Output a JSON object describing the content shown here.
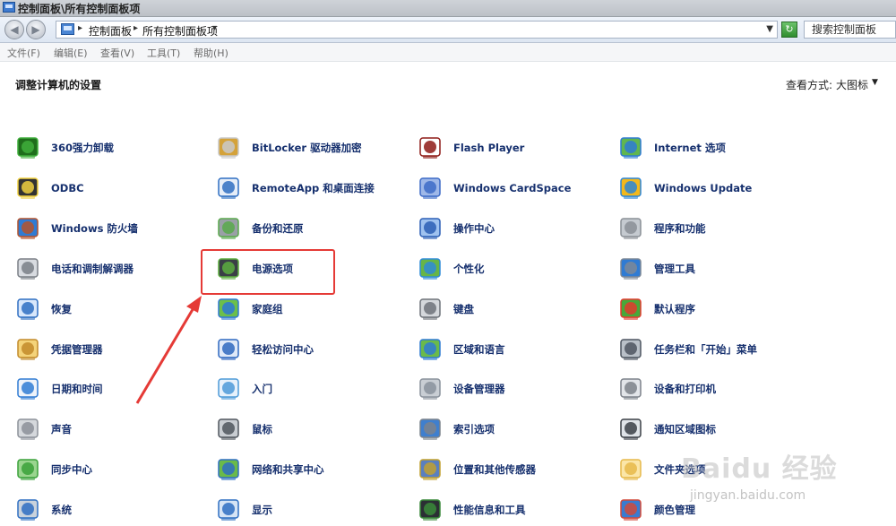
{
  "window": {
    "title": "控制面板\\所有控制面板项"
  },
  "address": {
    "crumbs": [
      "控制面板",
      "所有控制面板项"
    ],
    "search_placeholder": "搜索控制面板"
  },
  "menu": [
    {
      "label": "文件(F)"
    },
    {
      "label": "编辑(E)"
    },
    {
      "label": "查看(V)"
    },
    {
      "label": "工具(T)"
    },
    {
      "label": "帮助(H)"
    }
  ],
  "header": {
    "title": "调整计算机的设置",
    "view_by_label": "查看方式:",
    "view_by_value": "大图标"
  },
  "items": [
    {
      "label": "360强力卸载",
      "icon": "uninstall-icon"
    },
    {
      "label": "BitLocker 驱动器加密",
      "icon": "bitlocker-icon"
    },
    {
      "label": "Flash Player",
      "icon": "flash-icon"
    },
    {
      "label": "Internet 选项",
      "icon": "internet-options-icon"
    },
    {
      "label": "ODBC",
      "icon": "odbc-icon"
    },
    {
      "label": "RemoteApp 和桌面连接",
      "icon": "remoteapp-icon"
    },
    {
      "label": "Windows CardSpace",
      "icon": "cardspace-icon"
    },
    {
      "label": "Windows Update",
      "icon": "windows-update-icon"
    },
    {
      "label": "Windows 防火墙",
      "icon": "firewall-icon"
    },
    {
      "label": "备份和还原",
      "icon": "backup-icon"
    },
    {
      "label": "操作中心",
      "icon": "action-center-icon"
    },
    {
      "label": "程序和功能",
      "icon": "programs-icon"
    },
    {
      "label": "电话和调制解调器",
      "icon": "phone-modem-icon"
    },
    {
      "label": "电源选项",
      "icon": "power-options-icon"
    },
    {
      "label": "个性化",
      "icon": "personalization-icon"
    },
    {
      "label": "管理工具",
      "icon": "admin-tools-icon"
    },
    {
      "label": "恢复",
      "icon": "recovery-icon"
    },
    {
      "label": "家庭组",
      "icon": "homegroup-icon"
    },
    {
      "label": "键盘",
      "icon": "keyboard-icon"
    },
    {
      "label": "默认程序",
      "icon": "default-programs-icon"
    },
    {
      "label": "凭据管理器",
      "icon": "credential-manager-icon"
    },
    {
      "label": "轻松访问中心",
      "icon": "ease-of-access-icon"
    },
    {
      "label": "区域和语言",
      "icon": "region-language-icon"
    },
    {
      "label": "任务栏和「开始」菜单",
      "icon": "taskbar-icon"
    },
    {
      "label": "日期和时间",
      "icon": "date-time-icon"
    },
    {
      "label": "入门",
      "icon": "getting-started-icon"
    },
    {
      "label": "设备管理器",
      "icon": "device-manager-icon"
    },
    {
      "label": "设备和打印机",
      "icon": "printer-icon"
    },
    {
      "label": "声音",
      "icon": "sound-icon"
    },
    {
      "label": "鼠标",
      "icon": "mouse-icon"
    },
    {
      "label": "索引选项",
      "icon": "indexing-icon"
    },
    {
      "label": "通知区域图标",
      "icon": "notification-icon"
    },
    {
      "label": "同步中心",
      "icon": "sync-center-icon"
    },
    {
      "label": "网络和共享中心",
      "icon": "network-icon"
    },
    {
      "label": "位置和其他传感器",
      "icon": "location-sensor-icon"
    },
    {
      "label": "文件夹选项",
      "icon": "folder-options-icon"
    },
    {
      "label": "系统",
      "icon": "system-icon"
    },
    {
      "label": "显示",
      "icon": "display-icon"
    },
    {
      "label": "性能信息和工具",
      "icon": "performance-icon"
    },
    {
      "label": "颜色管理",
      "icon": "color-management-icon"
    }
  ],
  "watermark": {
    "logo": "Baidu 经验",
    "url": "jingyan.baidu.com"
  }
}
